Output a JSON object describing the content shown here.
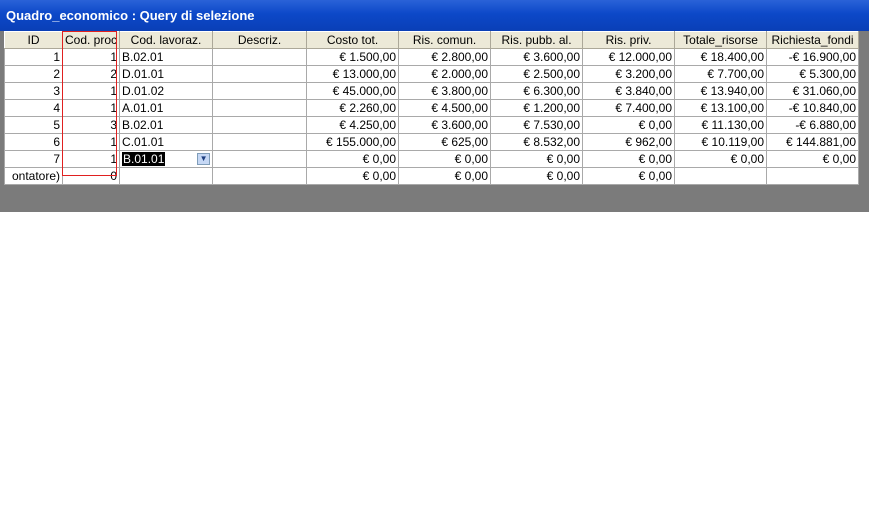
{
  "window": {
    "title": "Quadro_economico : Query di selezione"
  },
  "columns": [
    "ID",
    "Cod. proc",
    "Cod. lavoraz.",
    "Descriz.",
    "Costo tot.",
    "Ris. comun.",
    "Ris. pubb. al.",
    "Ris. priv.",
    "Totale_risorse",
    "Richiesta_fondi"
  ],
  "rows": [
    [
      "1",
      "1",
      "B.02.01",
      "",
      "€ 1.500,00",
      "€ 2.800,00",
      "€ 3.600,00",
      "€ 12.000,00",
      "€ 18.400,00",
      "-€ 16.900,00"
    ],
    [
      "2",
      "2",
      "D.01.01",
      "",
      "€ 13.000,00",
      "€ 2.000,00",
      "€ 2.500,00",
      "€ 3.200,00",
      "€ 7.700,00",
      "€ 5.300,00"
    ],
    [
      "3",
      "1",
      "D.01.02",
      "",
      "€ 45.000,00",
      "€ 3.800,00",
      "€ 6.300,00",
      "€ 3.840,00",
      "€ 13.940,00",
      "€ 31.060,00"
    ],
    [
      "4",
      "1",
      "A.01.01",
      "",
      "€ 2.260,00",
      "€ 4.500,00",
      "€ 1.200,00",
      "€ 7.400,00",
      "€ 13.100,00",
      "-€ 10.840,00"
    ],
    [
      "5",
      "3",
      "B.02.01",
      "",
      "€ 4.250,00",
      "€ 3.600,00",
      "€ 7.530,00",
      "€ 0,00",
      "€ 11.130,00",
      "-€ 6.880,00"
    ],
    [
      "6",
      "1",
      "C.01.01",
      "",
      "€ 155.000,00",
      "€ 625,00",
      "€ 8.532,00",
      "€ 962,00",
      "€ 10.119,00",
      "€ 144.881,00"
    ],
    [
      "7",
      "1",
      "B.01.01",
      "",
      "€ 0,00",
      "€ 0,00",
      "€ 0,00",
      "€ 0,00",
      "€ 0,00",
      "€ 0,00"
    ],
    [
      "ontatore)",
      "0",
      "",
      "",
      "€ 0,00",
      "€ 0,00",
      "€ 0,00",
      "€ 0,00",
      "",
      ""
    ]
  ],
  "selected_cell": {
    "row": 6,
    "col": 2,
    "value": "B.01.01",
    "dropdown_icon": "chevron-down-icon"
  },
  "colors": {
    "titlebar": "#0c48c8",
    "highlight_border": "#e02020",
    "background": "#7b7b7b"
  }
}
